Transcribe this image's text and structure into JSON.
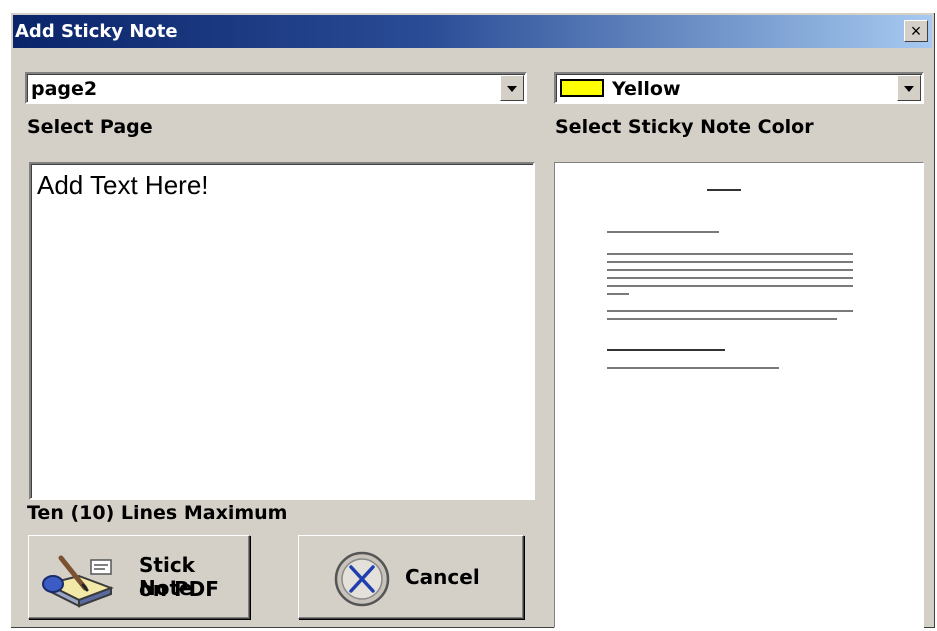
{
  "window": {
    "title": "Add Sticky Note",
    "close_glyph": "×"
  },
  "page_select": {
    "value": "page2",
    "label": "Select Page"
  },
  "color_select": {
    "value": "Yellow",
    "swatch_color": "#ffff00",
    "label": "Select Sticky Note Color"
  },
  "note": {
    "text": "Add Text Here!",
    "limit_label": "Ten (10) Lines Maximum"
  },
  "buttons": {
    "stick_line1": "Stick Note",
    "stick_line2": "on PDF",
    "cancel": "Cancel"
  },
  "icons": {
    "stick": "note-with-pen-icon",
    "cancel": "x-circle-icon",
    "dropdown": "chevron-down-icon",
    "close": "close-icon"
  }
}
